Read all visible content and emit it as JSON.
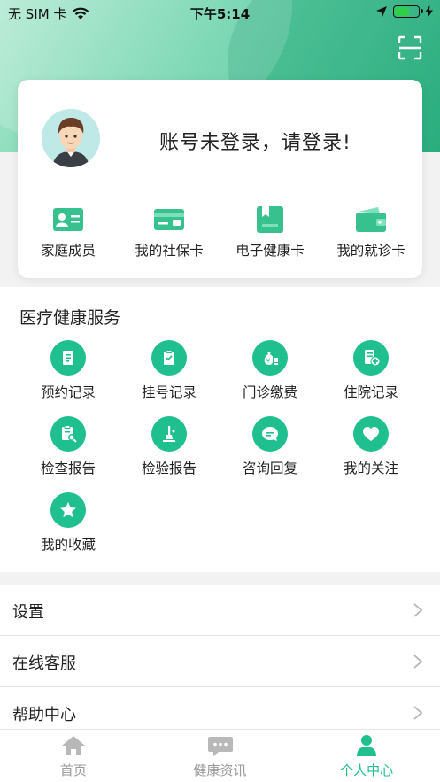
{
  "status_bar": {
    "carrier": "无 SIM 卡",
    "time": "下午5:14"
  },
  "header": {
    "scan_icon": "scan-icon"
  },
  "profile": {
    "login_prompt": "账号未登录，请登录!",
    "quick_links": [
      {
        "label": "家庭成员",
        "icon": "family-card-icon"
      },
      {
        "label": "我的社保卡",
        "icon": "social-security-card-icon"
      },
      {
        "label": "电子健康卡",
        "icon": "health-card-icon"
      },
      {
        "label": "我的就诊卡",
        "icon": "visit-card-icon"
      }
    ]
  },
  "services": {
    "title": "医疗健康服务",
    "items": [
      {
        "label": "预约记录",
        "icon": "document-icon"
      },
      {
        "label": "挂号记录",
        "icon": "clipboard-check-icon"
      },
      {
        "label": "门诊缴费",
        "icon": "money-bag-icon"
      },
      {
        "label": "住院记录",
        "icon": "hospital-record-icon"
      },
      {
        "label": "检查报告",
        "icon": "inspection-report-icon"
      },
      {
        "label": "检验报告",
        "icon": "lab-flask-icon"
      },
      {
        "label": "咨询回复",
        "icon": "chat-bubble-icon"
      },
      {
        "label": "我的关注",
        "icon": "heart-icon"
      },
      {
        "label": "我的收藏",
        "icon": "star-icon"
      }
    ]
  },
  "menu": {
    "items": [
      {
        "label": "设置"
      },
      {
        "label": "在线客服"
      },
      {
        "label": "帮助中心"
      }
    ]
  },
  "tabbar": {
    "tabs": [
      {
        "label": "首页",
        "icon": "home-icon",
        "active": false
      },
      {
        "label": "健康资讯",
        "icon": "news-chat-icon",
        "active": false
      },
      {
        "label": "个人中心",
        "icon": "person-icon",
        "active": true
      }
    ]
  },
  "colors": {
    "accent": "#1fbf8f",
    "inactive": "#999999"
  }
}
